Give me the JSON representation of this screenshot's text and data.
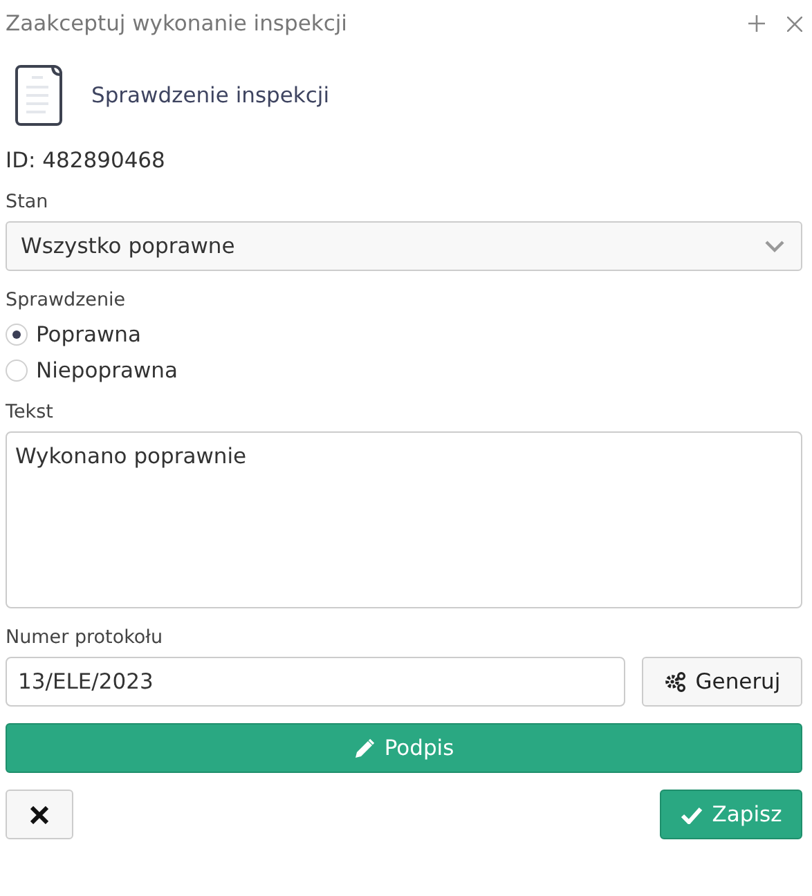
{
  "window": {
    "title": "Zaakceptuj wykonanie inspekcji"
  },
  "header": {
    "title": "Sprawdzenie inspekcji"
  },
  "id_line": "ID: 482890468",
  "state": {
    "label": "Stan",
    "value": "Wszystko poprawne"
  },
  "check": {
    "label": "Sprawdzenie",
    "options": [
      {
        "label": "Poprawna",
        "selected": true
      },
      {
        "label": "Niepoprawna",
        "selected": false
      }
    ]
  },
  "text": {
    "label": "Tekst",
    "value": "Wykonano poprawnie"
  },
  "protocol": {
    "label": "Numer protokołu",
    "value": "13/ELE/2023",
    "button": "Generuj"
  },
  "sign_button": "Podpis",
  "save_button": "Zapisz"
}
